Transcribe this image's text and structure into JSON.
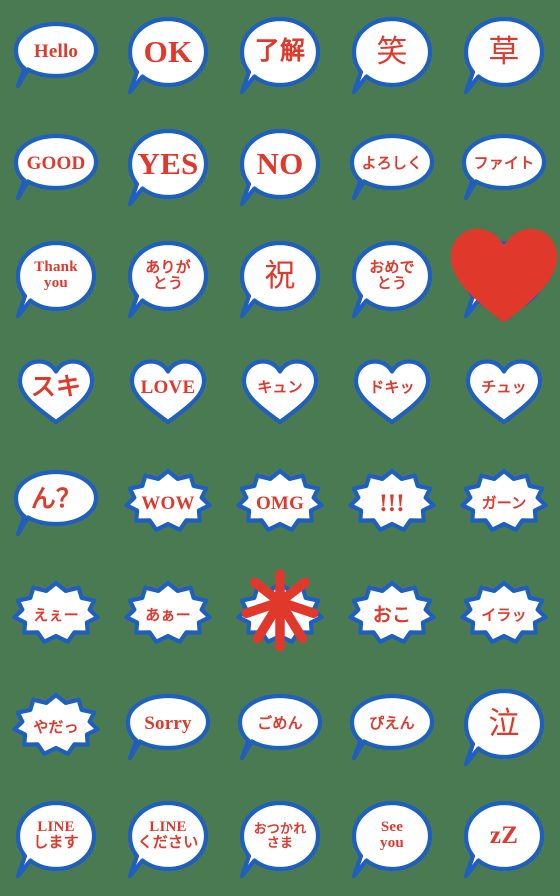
{
  "sheet": {
    "title": "LINE Speech Bubble Emoji Sheet",
    "background_color": "#4a7a52",
    "outline_color": "#1f5fc0",
    "fill_color": "#ffffff",
    "text_color": "#e0392c",
    "columns": 5,
    "rows": 8,
    "cell_size": 112
  },
  "stickers": [
    {
      "id": 1,
      "row": 1,
      "col": 1,
      "text": "Hello",
      "lines": [
        "Hello"
      ],
      "shape": "oval",
      "size": "md",
      "font": "serif"
    },
    {
      "id": 2,
      "row": 1,
      "col": 2,
      "text": "OK",
      "lines": [
        "OK"
      ],
      "shape": "round",
      "size": "xl",
      "font": "serif"
    },
    {
      "id": 3,
      "row": 1,
      "col": 3,
      "text": "了解",
      "lines": [
        "了解"
      ],
      "shape": "round",
      "size": "lg",
      "font": "sans"
    },
    {
      "id": 4,
      "row": 1,
      "col": 4,
      "text": "笑",
      "lines": [
        "笑"
      ],
      "shape": "round",
      "size": "xl",
      "font": "sans"
    },
    {
      "id": 5,
      "row": 1,
      "col": 5,
      "text": "草",
      "lines": [
        "草"
      ],
      "shape": "round",
      "size": "xl",
      "font": "sans"
    },
    {
      "id": 6,
      "row": 2,
      "col": 1,
      "text": "GOOD",
      "lines": [
        "GOOD"
      ],
      "shape": "oval",
      "size": "md",
      "font": "serif"
    },
    {
      "id": 7,
      "row": 2,
      "col": 2,
      "text": "YES",
      "lines": [
        "YES"
      ],
      "shape": "round",
      "size": "xl",
      "font": "serif"
    },
    {
      "id": 8,
      "row": 2,
      "col": 3,
      "text": "NO",
      "lines": [
        "NO"
      ],
      "shape": "round",
      "size": "xl",
      "font": "serif"
    },
    {
      "id": 9,
      "row": 2,
      "col": 4,
      "text": "よろしく",
      "lines": [
        "よろしく"
      ],
      "shape": "oval",
      "size": "sm",
      "font": "sans"
    },
    {
      "id": 10,
      "row": 2,
      "col": 5,
      "text": "ファイト",
      "lines": [
        "ファイト"
      ],
      "shape": "oval",
      "size": "sm",
      "font": "sans"
    },
    {
      "id": 11,
      "row": 3,
      "col": 1,
      "text": "Thank you",
      "lines": [
        "Thank",
        "you"
      ],
      "shape": "round",
      "size": "two",
      "font": "serif"
    },
    {
      "id": 12,
      "row": 3,
      "col": 2,
      "text": "ありがとう",
      "lines": [
        "ありが",
        "とう"
      ],
      "shape": "round",
      "size": "two",
      "font": "sans"
    },
    {
      "id": 13,
      "row": 3,
      "col": 3,
      "text": "祝",
      "lines": [
        "祝"
      ],
      "shape": "round",
      "size": "xl",
      "font": "sans"
    },
    {
      "id": 14,
      "row": 3,
      "col": 4,
      "text": "おめでとう",
      "lines": [
        "おめで",
        "とう"
      ],
      "shape": "round",
      "size": "two",
      "font": "sans"
    },
    {
      "id": 15,
      "row": 3,
      "col": 5,
      "text": "♥",
      "lines": [],
      "shape": "round",
      "size": "md",
      "font": "sans",
      "glyph": "heart-filled"
    },
    {
      "id": 16,
      "row": 4,
      "col": 1,
      "text": "スキ",
      "lines": [
        "スキ"
      ],
      "shape": "heart",
      "size": "lg",
      "font": "sans"
    },
    {
      "id": 17,
      "row": 4,
      "col": 2,
      "text": "LOVE",
      "lines": [
        "LOVE"
      ],
      "shape": "heart",
      "size": "md",
      "font": "serif"
    },
    {
      "id": 18,
      "row": 4,
      "col": 3,
      "text": "キュン",
      "lines": [
        "キュン"
      ],
      "shape": "heart",
      "size": "sm",
      "font": "sans"
    },
    {
      "id": 19,
      "row": 4,
      "col": 4,
      "text": "ドキッ",
      "lines": [
        "ドキッ"
      ],
      "shape": "heart",
      "size": "sm",
      "font": "sans"
    },
    {
      "id": 20,
      "row": 4,
      "col": 5,
      "text": "チュッ",
      "lines": [
        "チュッ"
      ],
      "shape": "heart",
      "size": "sm",
      "font": "sans"
    },
    {
      "id": 21,
      "row": 5,
      "col": 1,
      "text": "ん？",
      "lines": [
        "ん？"
      ],
      "shape": "oval",
      "size": "lg",
      "font": "sans"
    },
    {
      "id": 22,
      "row": 5,
      "col": 2,
      "text": "WOW",
      "lines": [
        "WOW"
      ],
      "shape": "burst",
      "size": "md",
      "font": "serif"
    },
    {
      "id": 23,
      "row": 5,
      "col": 3,
      "text": "OMG",
      "lines": [
        "OMG"
      ],
      "shape": "burst",
      "size": "md",
      "font": "serif"
    },
    {
      "id": 24,
      "row": 5,
      "col": 4,
      "text": "!!!",
      "lines": [
        "!!!"
      ],
      "shape": "burst",
      "size": "lg",
      "font": "serif"
    },
    {
      "id": 25,
      "row": 5,
      "col": 5,
      "text": "ガーン",
      "lines": [
        "ガーン"
      ],
      "shape": "burst",
      "size": "sm",
      "font": "sans"
    },
    {
      "id": 26,
      "row": 6,
      "col": 1,
      "text": "えぇー",
      "lines": [
        "えぇー"
      ],
      "shape": "burst",
      "size": "sm",
      "font": "sans"
    },
    {
      "id": 27,
      "row": 6,
      "col": 2,
      "text": "あぁー",
      "lines": [
        "あぁー"
      ],
      "shape": "burst",
      "size": "sm",
      "font": "sans"
    },
    {
      "id": 28,
      "row": 6,
      "col": 3,
      "text": "💢",
      "lines": [],
      "shape": "burst",
      "size": "md",
      "font": "sans",
      "glyph": "anger-mark"
    },
    {
      "id": 29,
      "row": 6,
      "col": 4,
      "text": "おこ",
      "lines": [
        "おこ"
      ],
      "shape": "burst",
      "size": "md",
      "font": "sans"
    },
    {
      "id": 30,
      "row": 6,
      "col": 5,
      "text": "イラッ",
      "lines": [
        "イラッ"
      ],
      "shape": "burst",
      "size": "sm",
      "font": "sans"
    },
    {
      "id": 31,
      "row": 7,
      "col": 1,
      "text": "やだっ",
      "lines": [
        "やだっ"
      ],
      "shape": "burst",
      "size": "sm",
      "font": "sans"
    },
    {
      "id": 32,
      "row": 7,
      "col": 2,
      "text": "Sorry",
      "lines": [
        "Sorry"
      ],
      "shape": "oval",
      "size": "md",
      "font": "serif"
    },
    {
      "id": 33,
      "row": 7,
      "col": 3,
      "text": "ごめん",
      "lines": [
        "ごめん"
      ],
      "shape": "oval",
      "size": "sm",
      "font": "sans"
    },
    {
      "id": 34,
      "row": 7,
      "col": 4,
      "text": "ぴえん",
      "lines": [
        "ぴえん"
      ],
      "shape": "oval",
      "size": "sm",
      "font": "sans"
    },
    {
      "id": 35,
      "row": 7,
      "col": 5,
      "text": "泣",
      "lines": [
        "泣"
      ],
      "shape": "round",
      "size": "xl",
      "font": "sans"
    },
    {
      "id": 36,
      "row": 8,
      "col": 1,
      "text": "LINEします",
      "lines": [
        "LINE",
        "します"
      ],
      "shape": "round",
      "size": "two",
      "font": "serif"
    },
    {
      "id": 37,
      "row": 8,
      "col": 2,
      "text": "LINEください",
      "lines": [
        "LINE",
        "ください"
      ],
      "shape": "round",
      "size": "two",
      "font": "serif"
    },
    {
      "id": 38,
      "row": 8,
      "col": 3,
      "text": "おつかれさま",
      "lines": [
        "おつかれ",
        "さま"
      ],
      "shape": "round",
      "size": "two-sm",
      "font": "sans"
    },
    {
      "id": 39,
      "row": 8,
      "col": 4,
      "text": "See you",
      "lines": [
        "See",
        "you"
      ],
      "shape": "round",
      "size": "two",
      "font": "serif"
    },
    {
      "id": 40,
      "row": 8,
      "col": 5,
      "text": "zZ",
      "lines": [
        "zZ"
      ],
      "shape": "round",
      "size": "lg",
      "font": "serif"
    }
  ]
}
